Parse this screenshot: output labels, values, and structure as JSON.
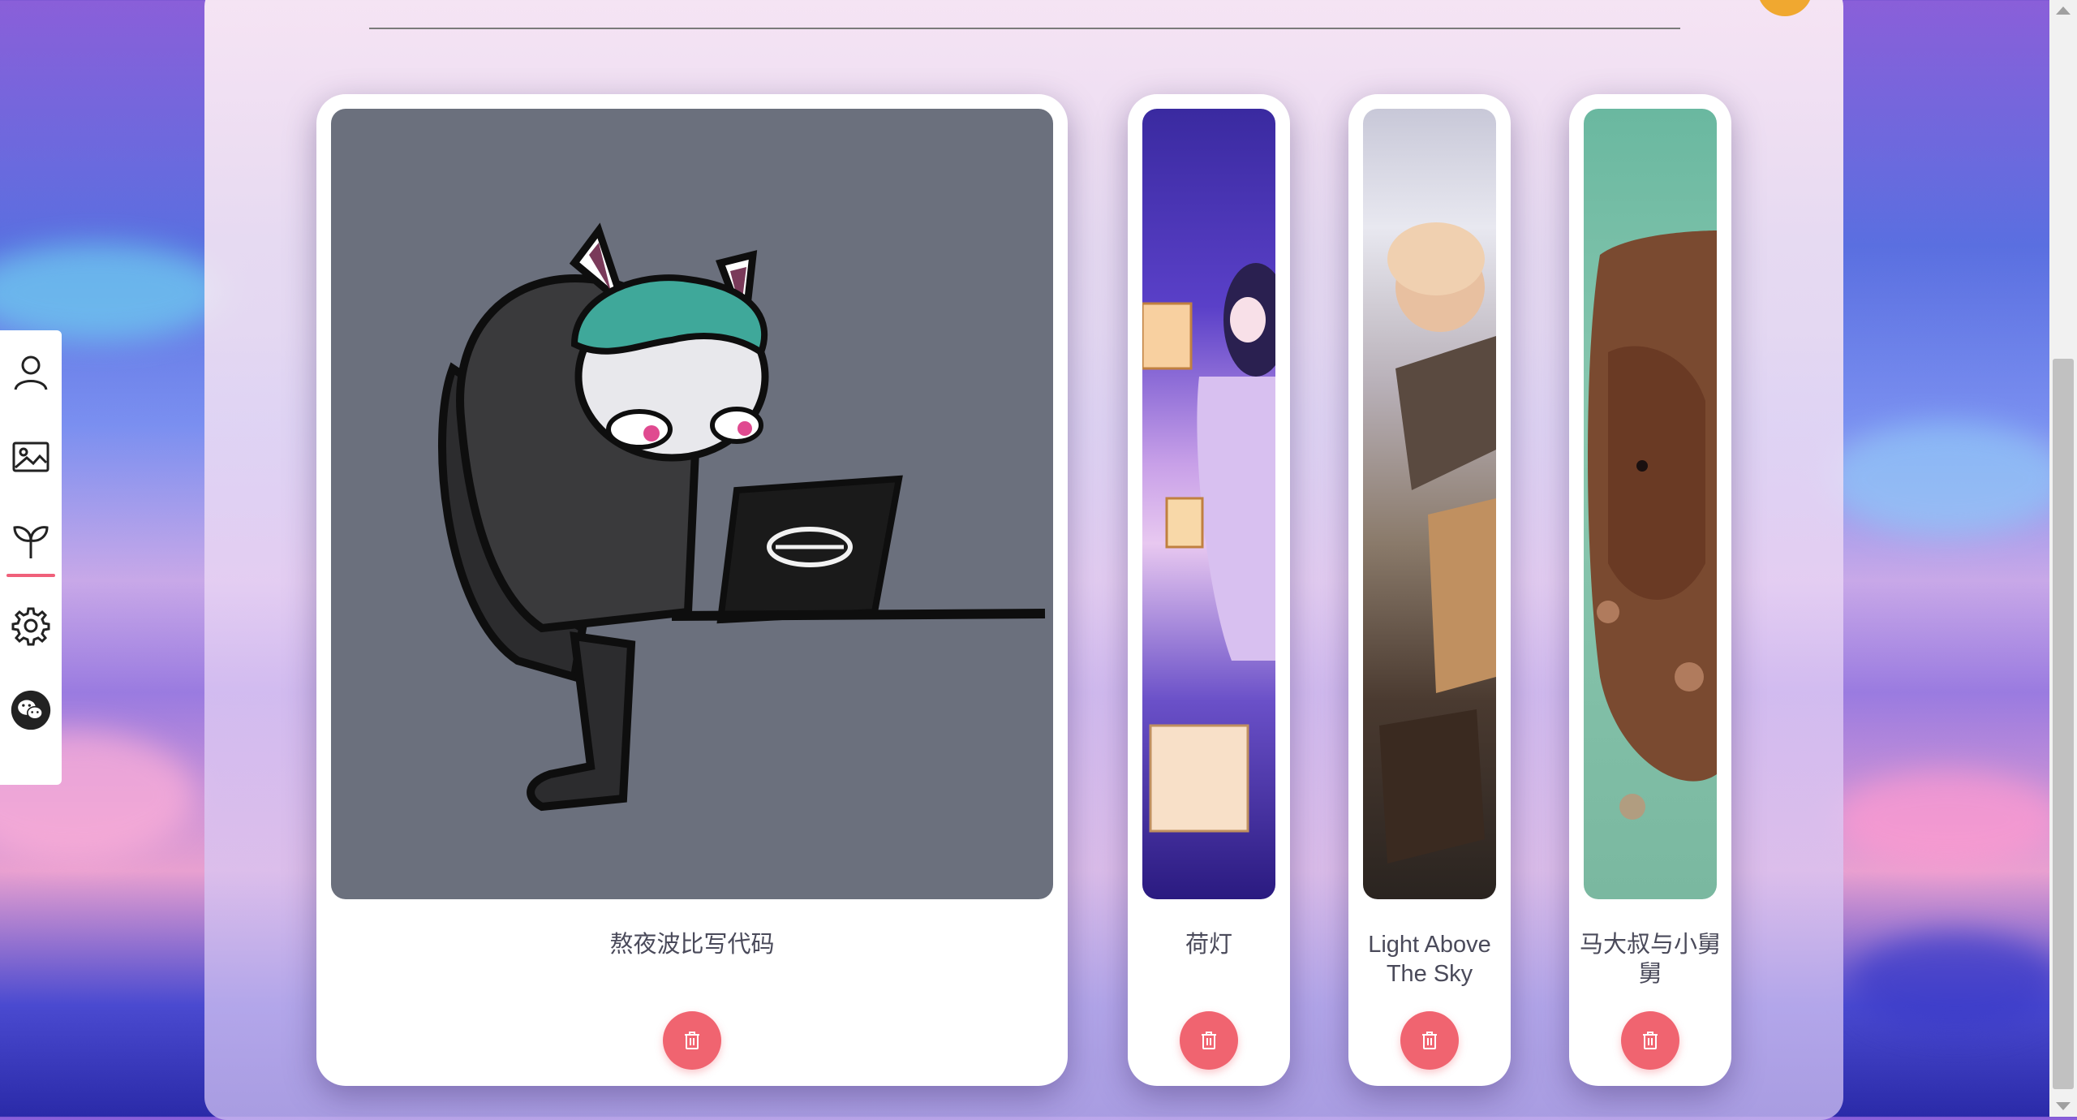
{
  "sidebar": {
    "items": [
      {
        "icon": "user-icon"
      },
      {
        "icon": "image-icon"
      },
      {
        "icon": "sprout-icon",
        "active": true
      },
      {
        "icon": "gear-icon"
      },
      {
        "icon": "wechat-icon"
      }
    ]
  },
  "cards": [
    {
      "title": "熬夜波比写代码",
      "icon": "trash-icon"
    },
    {
      "title": "荷灯",
      "icon": "trash-icon"
    },
    {
      "title": "Light Above The Sky",
      "icon": "trash-icon"
    },
    {
      "title": "马大叔与小舅舅",
      "icon": "trash-icon"
    }
  ],
  "colors": {
    "accent": "#f06470",
    "active_indicator": "#f0607a",
    "orange": "#f0a830",
    "card_bg": "#ffffff"
  }
}
